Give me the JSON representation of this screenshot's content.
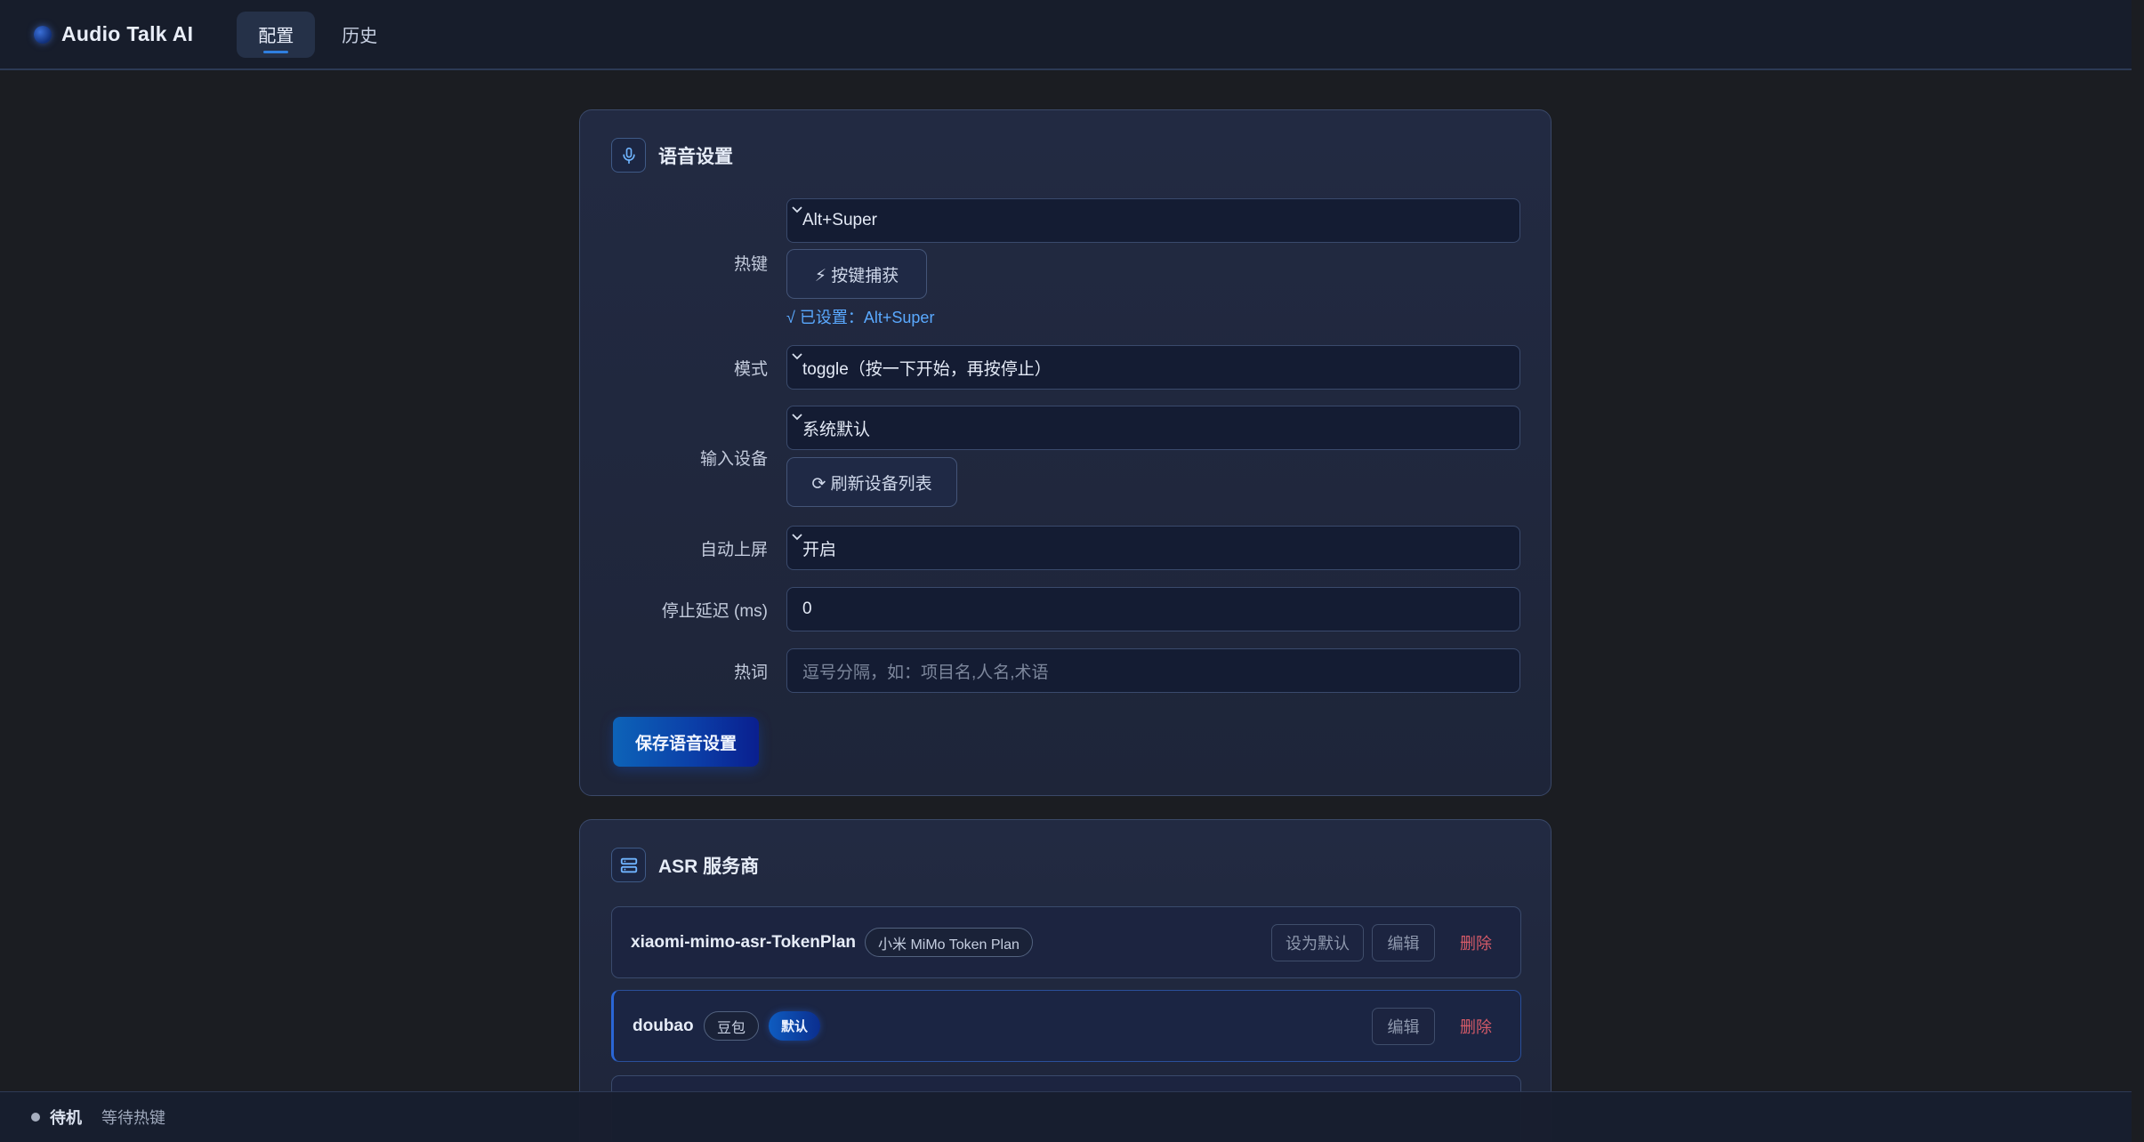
{
  "app": {
    "title": "Audio Talk AI"
  },
  "nav": {
    "tabs": [
      {
        "label": "配置",
        "active": true
      },
      {
        "label": "历史",
        "active": false
      }
    ]
  },
  "voice": {
    "title": "语音设置",
    "hotkey": {
      "label": "热键",
      "value": "Alt+Super",
      "capture_button": "⚡ 按键捕获",
      "status_prefix": "√ 已设置：",
      "status_value": "Alt+Super"
    },
    "mode": {
      "label": "模式",
      "value": "toggle（按一下开始，再按停止）"
    },
    "input_device": {
      "label": "输入设备",
      "value": "系统默认",
      "refresh_button": "⟳ 刷新设备列表"
    },
    "auto_commit": {
      "label": "自动上屏",
      "value": "开启"
    },
    "stop_delay": {
      "label": "停止延迟 (ms)",
      "value": "0"
    },
    "hotwords": {
      "label": "热词",
      "value": "",
      "placeholder": "逗号分隔，如：项目名,人名,术语"
    },
    "save_button": "保存语音设置"
  },
  "asr": {
    "title": "ASR 服务商",
    "providers": [
      {
        "name": "xiaomi-mimo-asr-TokenPlan",
        "tag": "小米 MiMo Token Plan",
        "is_default": false,
        "set_default_label": "设为默认",
        "edit_label": "编辑",
        "delete_label": "删除"
      },
      {
        "name": "doubao",
        "tag": "豆包",
        "is_default": true,
        "default_badge": "默认",
        "edit_label": "编辑",
        "delete_label": "删除"
      }
    ]
  },
  "status": {
    "state": "待机",
    "message": "等待热键"
  },
  "colors": {
    "accent": "#2f7fe0",
    "link": "#5aa9ff",
    "danger": "#d45a68",
    "background": "#1b1d22"
  }
}
